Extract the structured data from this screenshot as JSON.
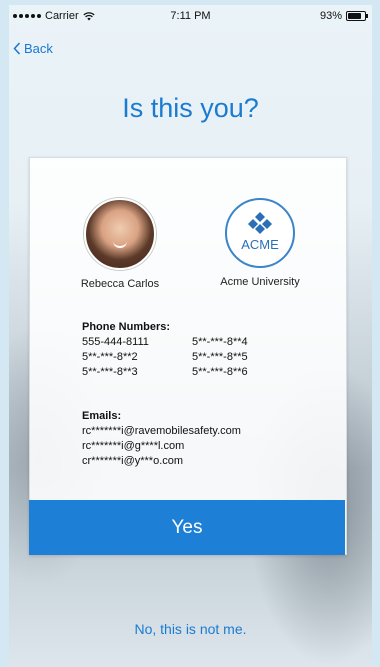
{
  "status_bar": {
    "carrier": "Carrier",
    "time": "7:11 PM",
    "battery": "93%",
    "battery_level": 0.93
  },
  "nav": {
    "back_label": "Back"
  },
  "page": {
    "title": "Is this you?"
  },
  "card": {
    "person_name": "Rebecca Carlos",
    "org_logo_text": "ACME",
    "org_name": "Acme University",
    "phones_heading": "Phone Numbers:",
    "phones": [
      "555-444-8111",
      "5**-***-8**4",
      "5**-***-8**2",
      "5**-***-8**5",
      "5**-***-8**3",
      "5**-***-8**6"
    ],
    "emails_heading": "Emails:",
    "emails": [
      "rc*******i@ravemobilesafety.com",
      "rc*******i@g****l.com",
      "cr*******i@y***o.com"
    ]
  },
  "actions": {
    "yes_label": "Yes",
    "no_label": "No, this is not me."
  },
  "colors": {
    "accent": "#1d7fd6",
    "link": "#1b7bd1"
  }
}
